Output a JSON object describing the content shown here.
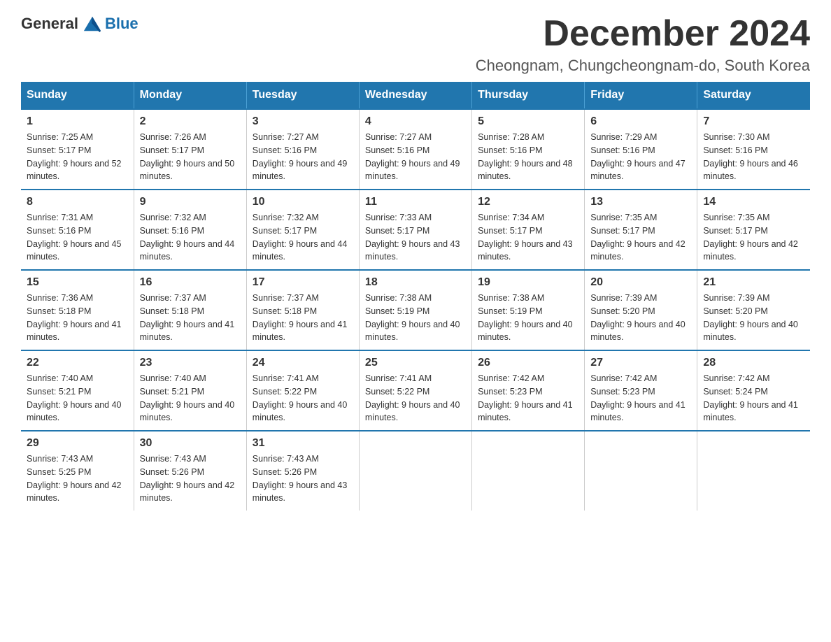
{
  "header": {
    "logo": {
      "general": "General",
      "blue": "Blue"
    },
    "month_title": "December 2024",
    "location": "Cheongnam, Chungcheongnam-do, South Korea"
  },
  "days_of_week": [
    "Sunday",
    "Monday",
    "Tuesday",
    "Wednesday",
    "Thursday",
    "Friday",
    "Saturday"
  ],
  "weeks": [
    [
      {
        "day": "1",
        "sunrise": "7:25 AM",
        "sunset": "5:17 PM",
        "daylight": "9 hours and 52 minutes."
      },
      {
        "day": "2",
        "sunrise": "7:26 AM",
        "sunset": "5:17 PM",
        "daylight": "9 hours and 50 minutes."
      },
      {
        "day": "3",
        "sunrise": "7:27 AM",
        "sunset": "5:16 PM",
        "daylight": "9 hours and 49 minutes."
      },
      {
        "day": "4",
        "sunrise": "7:27 AM",
        "sunset": "5:16 PM",
        "daylight": "9 hours and 49 minutes."
      },
      {
        "day": "5",
        "sunrise": "7:28 AM",
        "sunset": "5:16 PM",
        "daylight": "9 hours and 48 minutes."
      },
      {
        "day": "6",
        "sunrise": "7:29 AM",
        "sunset": "5:16 PM",
        "daylight": "9 hours and 47 minutes."
      },
      {
        "day": "7",
        "sunrise": "7:30 AM",
        "sunset": "5:16 PM",
        "daylight": "9 hours and 46 minutes."
      }
    ],
    [
      {
        "day": "8",
        "sunrise": "7:31 AM",
        "sunset": "5:16 PM",
        "daylight": "9 hours and 45 minutes."
      },
      {
        "day": "9",
        "sunrise": "7:32 AM",
        "sunset": "5:16 PM",
        "daylight": "9 hours and 44 minutes."
      },
      {
        "day": "10",
        "sunrise": "7:32 AM",
        "sunset": "5:17 PM",
        "daylight": "9 hours and 44 minutes."
      },
      {
        "day": "11",
        "sunrise": "7:33 AM",
        "sunset": "5:17 PM",
        "daylight": "9 hours and 43 minutes."
      },
      {
        "day": "12",
        "sunrise": "7:34 AM",
        "sunset": "5:17 PM",
        "daylight": "9 hours and 43 minutes."
      },
      {
        "day": "13",
        "sunrise": "7:35 AM",
        "sunset": "5:17 PM",
        "daylight": "9 hours and 42 minutes."
      },
      {
        "day": "14",
        "sunrise": "7:35 AM",
        "sunset": "5:17 PM",
        "daylight": "9 hours and 42 minutes."
      }
    ],
    [
      {
        "day": "15",
        "sunrise": "7:36 AM",
        "sunset": "5:18 PM",
        "daylight": "9 hours and 41 minutes."
      },
      {
        "day": "16",
        "sunrise": "7:37 AM",
        "sunset": "5:18 PM",
        "daylight": "9 hours and 41 minutes."
      },
      {
        "day": "17",
        "sunrise": "7:37 AM",
        "sunset": "5:18 PM",
        "daylight": "9 hours and 41 minutes."
      },
      {
        "day": "18",
        "sunrise": "7:38 AM",
        "sunset": "5:19 PM",
        "daylight": "9 hours and 40 minutes."
      },
      {
        "day": "19",
        "sunrise": "7:38 AM",
        "sunset": "5:19 PM",
        "daylight": "9 hours and 40 minutes."
      },
      {
        "day": "20",
        "sunrise": "7:39 AM",
        "sunset": "5:20 PM",
        "daylight": "9 hours and 40 minutes."
      },
      {
        "day": "21",
        "sunrise": "7:39 AM",
        "sunset": "5:20 PM",
        "daylight": "9 hours and 40 minutes."
      }
    ],
    [
      {
        "day": "22",
        "sunrise": "7:40 AM",
        "sunset": "5:21 PM",
        "daylight": "9 hours and 40 minutes."
      },
      {
        "day": "23",
        "sunrise": "7:40 AM",
        "sunset": "5:21 PM",
        "daylight": "9 hours and 40 minutes."
      },
      {
        "day": "24",
        "sunrise": "7:41 AM",
        "sunset": "5:22 PM",
        "daylight": "9 hours and 40 minutes."
      },
      {
        "day": "25",
        "sunrise": "7:41 AM",
        "sunset": "5:22 PM",
        "daylight": "9 hours and 40 minutes."
      },
      {
        "day": "26",
        "sunrise": "7:42 AM",
        "sunset": "5:23 PM",
        "daylight": "9 hours and 41 minutes."
      },
      {
        "day": "27",
        "sunrise": "7:42 AM",
        "sunset": "5:23 PM",
        "daylight": "9 hours and 41 minutes."
      },
      {
        "day": "28",
        "sunrise": "7:42 AM",
        "sunset": "5:24 PM",
        "daylight": "9 hours and 41 minutes."
      }
    ],
    [
      {
        "day": "29",
        "sunrise": "7:43 AM",
        "sunset": "5:25 PM",
        "daylight": "9 hours and 42 minutes."
      },
      {
        "day": "30",
        "sunrise": "7:43 AM",
        "sunset": "5:26 PM",
        "daylight": "9 hours and 42 minutes."
      },
      {
        "day": "31",
        "sunrise": "7:43 AM",
        "sunset": "5:26 PM",
        "daylight": "9 hours and 43 minutes."
      },
      null,
      null,
      null,
      null
    ]
  ]
}
